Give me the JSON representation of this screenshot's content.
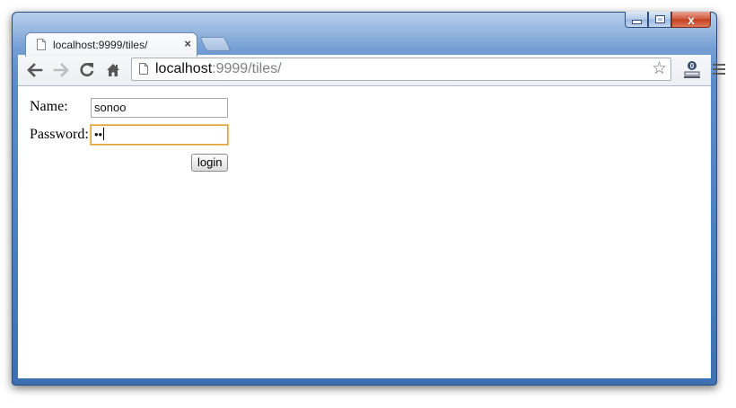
{
  "browser": {
    "tab": {
      "title": "localhost:9999/tiles/",
      "close_glyph": "×"
    },
    "address_bar": {
      "host": "localhost",
      "path": ":9999/tiles/"
    },
    "icons": [
      "back-icon",
      "forward-icon",
      "reload-icon",
      "home-icon",
      "page-icon",
      "star-icon",
      "extension-icon",
      "menu-icon"
    ],
    "caption": {
      "close_glyph": "x"
    }
  },
  "login_form": {
    "name_label": "Name:",
    "name_value": "sonoo",
    "password_label": "Password:",
    "password_value": "••",
    "submit_label": "login"
  },
  "colors": {
    "focus_border": "#e2a23a",
    "window_frame": "#4c7fc2"
  }
}
